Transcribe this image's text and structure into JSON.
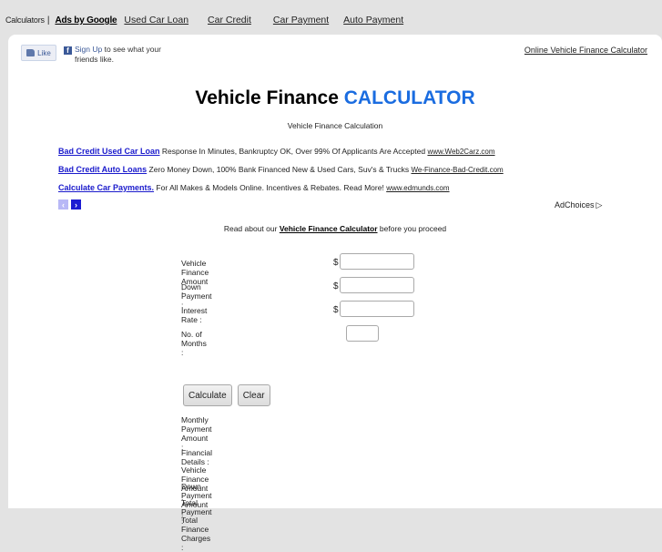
{
  "topnav": {
    "breadcrumb": "Calculators",
    "separator": "|",
    "ads_by": "Ads by Google",
    "links": [
      "Used Car Loan",
      "Car Credit",
      "Car Payment",
      "Auto Payment"
    ]
  },
  "facebook": {
    "like_label": "Like",
    "signup_label": "Sign Up",
    "signup_text_1": "to see what your",
    "signup_text_2": "friends like."
  },
  "header": {
    "top_right_link": "Online Vehicle Finance Calculator",
    "title_main": "Vehicle Finance",
    "title_accent": "CALCULATOR",
    "subtitle": "Vehicle Finance Calculation",
    "accent_color": "#1a6ce0"
  },
  "ads": [
    {
      "title": "Bad Credit Used Car Loan",
      "text": "Response In Minutes, Bankruptcy OK, Over 99% Of Applicants Are Accepted",
      "url": "www.Web2Carz.com"
    },
    {
      "title": "Bad Credit Auto Loans",
      "text": "Zero Money Down, 100% Bank Financed New & Used Cars, Suv's & Trucks",
      "url": "We-Finance-Bad-Credit.com"
    },
    {
      "title": "Calculate Car Payments.",
      "text": "For All Makes & Models Online. Incentives & Rebates. Read More!",
      "url": "www.edmunds.com"
    }
  ],
  "ad_nav": {
    "prev": "‹",
    "next": "›"
  },
  "adchoices": {
    "label": "AdChoices",
    "icon": "▷"
  },
  "read_about": {
    "prefix": "Read about our",
    "link": "Vehicle Finance Calculator",
    "suffix": "before you proceed"
  },
  "form": {
    "fields": [
      {
        "label": "Vehicle Finance Amount :",
        "currency": "$",
        "value": ""
      },
      {
        "label": "Down Payment :",
        "currency": "$",
        "value": ""
      },
      {
        "label": "Interest Rate :",
        "currency": "$",
        "value": ""
      },
      {
        "label": "No. of Months :",
        "value": ""
      }
    ],
    "calculate_label": "Calculate",
    "clear_label": "Clear"
  },
  "results": {
    "monthly_payment": "Monthly Payment Amount :",
    "financial_details": "Financial Details :",
    "vehicle_finance_amount": "Vehicle Finance Amount :",
    "down_payment_amount": "Down Payment Amount :",
    "total_payment": "Total Payment :",
    "total_finance_charges": "Total Finance Charges :"
  }
}
